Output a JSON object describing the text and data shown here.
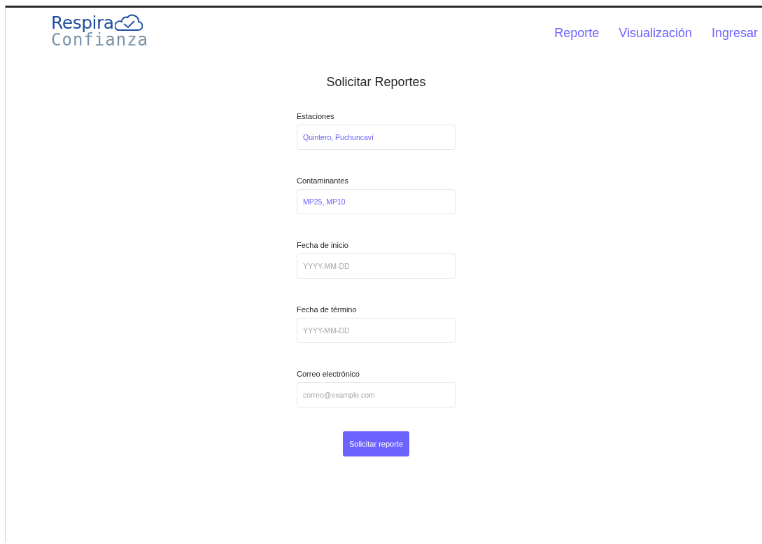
{
  "logo": {
    "line_1": "Respira",
    "line_2": "Confianza"
  },
  "nav": [
    {
      "label": "Reporte"
    },
    {
      "label": "Visualización"
    },
    {
      "label": "Ingresar"
    }
  ],
  "form": {
    "title": "Solicitar Reportes",
    "fields": [
      {
        "label": "Estaciones",
        "value": "Quintero, Puchuncaví"
      },
      {
        "label": "Contaminantes",
        "value": "MP25, MP10"
      },
      {
        "label": "Fecha de inicio",
        "placeholder": "YYYY-MM-DD"
      },
      {
        "label": "Fecha de término",
        "placeholder": "YYYY-MM-DD"
      },
      {
        "label": "Correo electrónico",
        "placeholder": "correo@example.com"
      }
    ],
    "submit": "Solicitar reporte"
  }
}
